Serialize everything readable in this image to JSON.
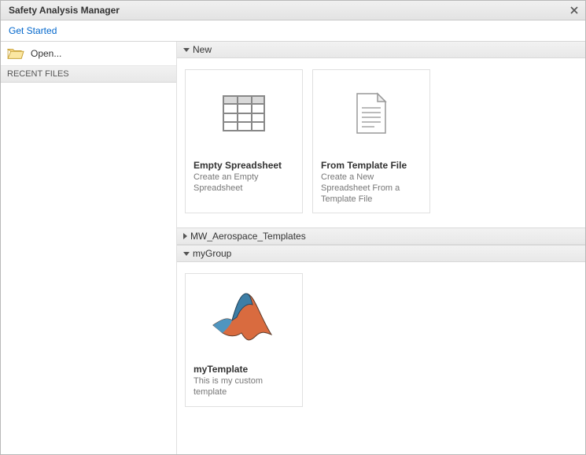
{
  "window": {
    "title": "Safety Analysis Manager",
    "get_started_label": "Get Started"
  },
  "sidebar": {
    "open_label": "Open...",
    "recent_header": "RECENT FILES"
  },
  "sections": {
    "new": {
      "label": "New",
      "cards": [
        {
          "title": "Empty Spreadsheet",
          "desc": "Create an Empty Spreadsheet"
        },
        {
          "title": "From Template File",
          "desc": "Create a New Spreadsheet From a Template File"
        }
      ]
    },
    "aerospace": {
      "label": "MW_Aerospace_Templates"
    },
    "mygroup": {
      "label": "myGroup",
      "cards": [
        {
          "title": "myTemplate",
          "desc": "This is my custom template"
        }
      ]
    }
  }
}
